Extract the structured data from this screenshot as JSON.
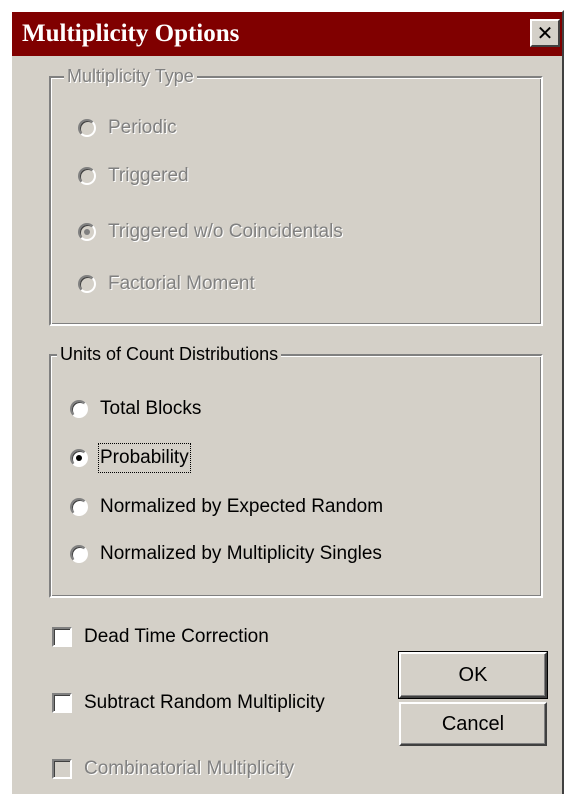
{
  "window": {
    "title": "Multiplicity Options",
    "close_symbol": "✕"
  },
  "multiplicity_type": {
    "legend": "Multiplicity Type",
    "options": [
      {
        "label": "Periodic",
        "selected": false
      },
      {
        "label": "Triggered",
        "selected": false
      },
      {
        "label": "Triggered w/o Coincidentals",
        "selected": true
      },
      {
        "label": "Factorial Moment",
        "selected": false
      }
    ]
  },
  "units": {
    "legend": "Units of Count Distributions",
    "options": [
      {
        "label": "Total Blocks",
        "selected": false
      },
      {
        "label": "Probability",
        "selected": true
      },
      {
        "label": "Normalized by Expected Random",
        "selected": false
      },
      {
        "label": "Normalized by Multiplicity Singles",
        "selected": false
      }
    ]
  },
  "checkboxes": {
    "dead_time": {
      "label": "Dead Time Correction",
      "checked": false
    },
    "subtract_random": {
      "label": "Subtract Random Multiplicity",
      "checked": false
    },
    "combinatorial": {
      "label": "Combinatorial Multiplicity",
      "checked": false,
      "disabled": true
    }
  },
  "buttons": {
    "ok": "OK",
    "cancel": "Cancel"
  },
  "colors": {
    "title_bar": "#800000",
    "face": "#d4d0c8"
  }
}
